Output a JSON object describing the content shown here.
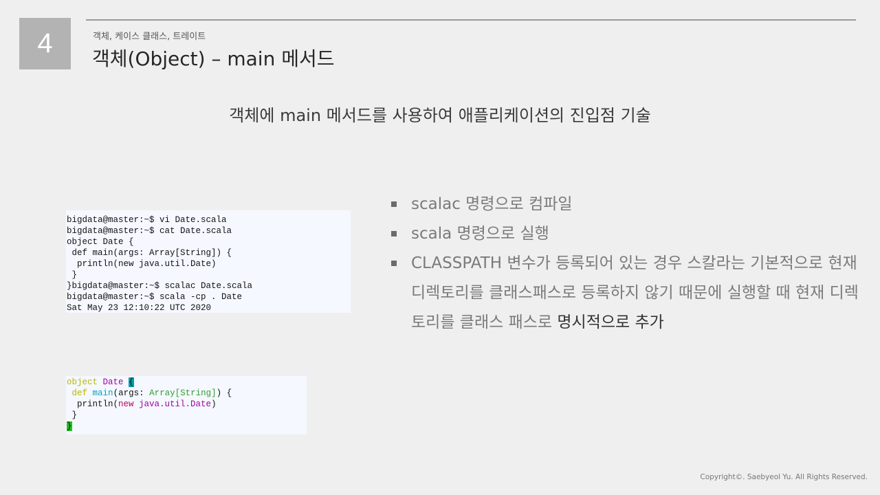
{
  "slide": {
    "number": "4"
  },
  "header": {
    "kicker": "객체, 케이스 클래스, 트레이트",
    "title": "객체(Object)  –  main 메서드"
  },
  "subtitle": "객체에 main 메서드를 사용하여 애플리케이션의 진입점 기술",
  "terminal_lines": [
    "bigdata@master:~$ vi Date.scala",
    "bigdata@master:~$ cat Date.scala",
    "object Date {",
    " def main(args: Array[String]) {",
    "  println(new java.util.Date)",
    " }",
    "}bigdata@master:~$ scalac Date.scala",
    "bigdata@master:~$ scala -cp . Date",
    "Sat May 23 12:10:22 UTC 2020"
  ],
  "editor": {
    "l1_kw": "object",
    "l1_name": " Date ",
    "l1_brace": "{",
    "l2_indent": " ",
    "l2_kw": "def",
    "l2_fn": "main",
    "l2_args": "(args: ",
    "l2_type": "Array[String]",
    "l2_end": ") {",
    "l3_pre": "  println(",
    "l3_new": "new",
    "l3_cls": " java.util.Date",
    "l3_end": ")",
    "l4": " }",
    "l5_brace": "}"
  },
  "bullets": [
    {
      "text": "scalac 명령으로 컴파일"
    },
    {
      "text": "scala 명령으로 실행"
    },
    {
      "text": "CLASSPATH 변수가 등록되어 있는 경우 스칼라는 기본적으로 현재 디렉토리를 클래스패스로 등록하지 않기 때문에 실행할 때 현재 디렉토리를 클래스 패스로 ",
      "emphasis": "명시적으로 추가"
    }
  ],
  "footer": "Copyright©. Saebyeol Yu. All Rights Reserved.",
  "colors": {
    "background": "#efefef",
    "badge": "#b3b3b3",
    "code_bg": "#f5f8ff",
    "keyword": "#b8b800",
    "class_name": "#a000a0",
    "function_name": "#00a0c0",
    "type_name": "#30a030",
    "new_keyword": "#c00060",
    "brace_highlight_open": "#00a0a8",
    "brace_highlight_close": "#20c020"
  }
}
